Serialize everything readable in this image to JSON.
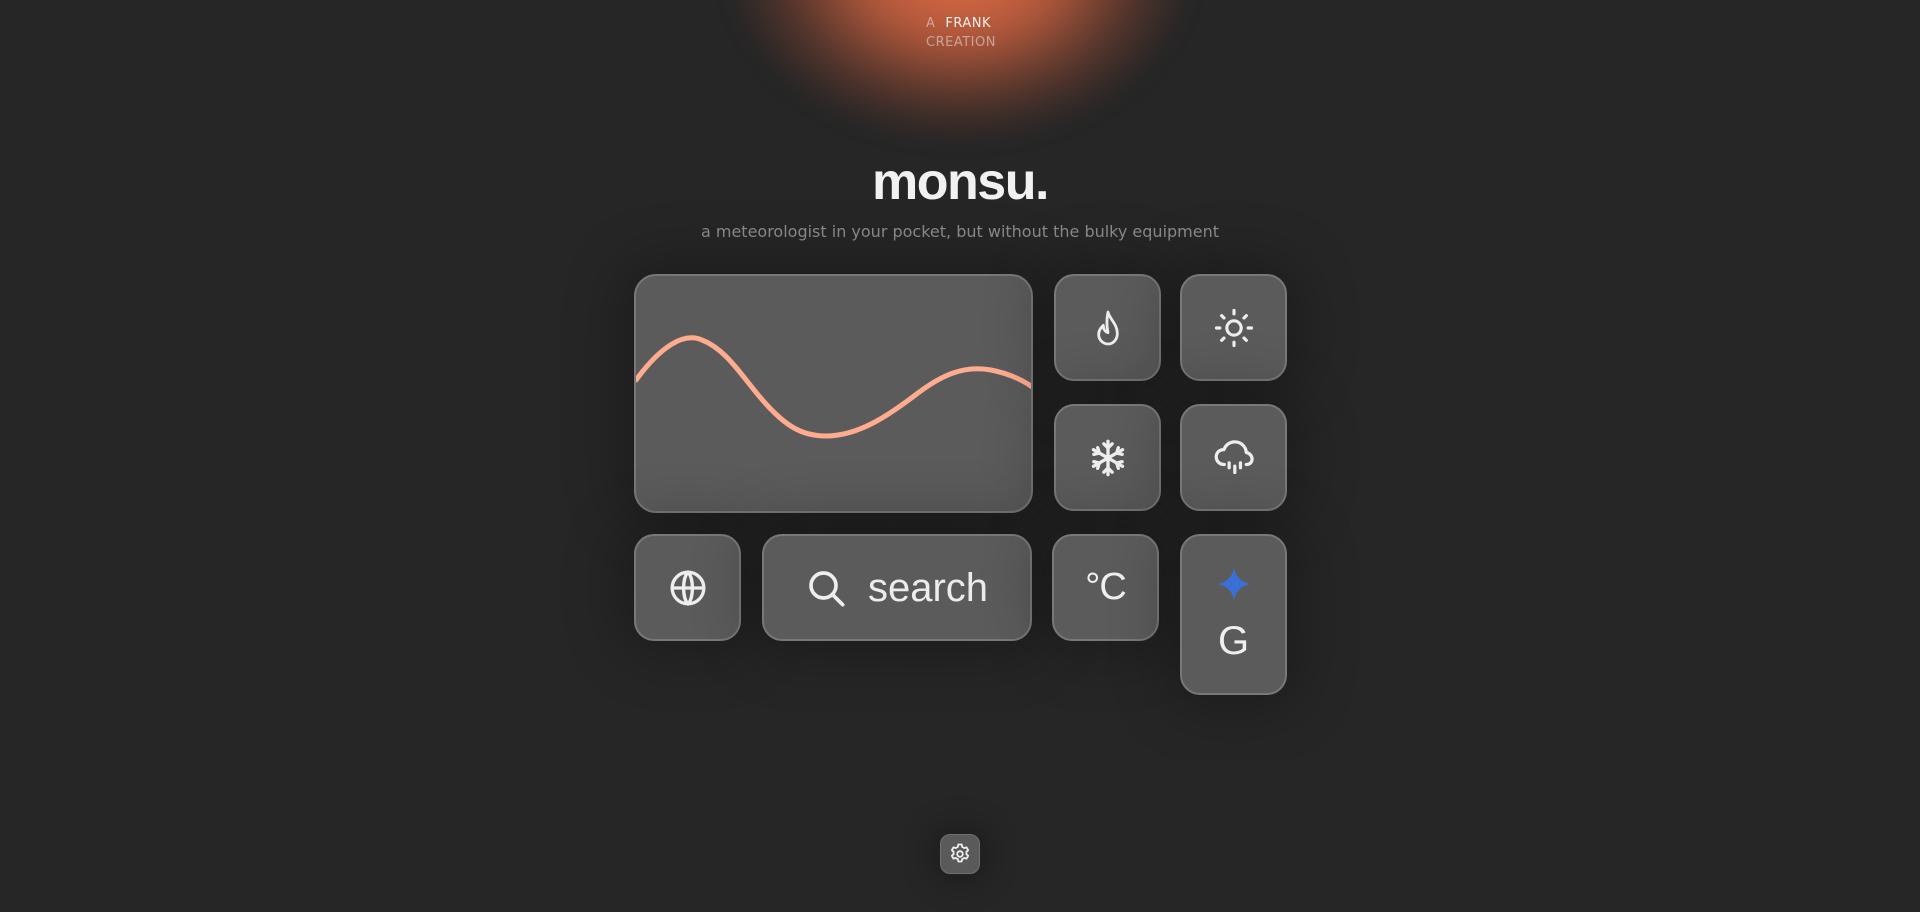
{
  "credit": {
    "prefix": "A",
    "name": "FRANK",
    "suffix": "CREATION"
  },
  "title": "monsu.",
  "subtitle": "a meteorologist in your pocket, but without the bulky equipment",
  "colors": {
    "background": "#262626",
    "tile": "#5b5b5b",
    "tile_border": "#787878",
    "wave": "#ffab8f",
    "glow": "#e46e46",
    "gemini_star": "#3a6fd8"
  },
  "tiles": {
    "wave_graph": {
      "icon": "temperature-wave"
    },
    "flame": {
      "icon": "flame-icon"
    },
    "sun": {
      "icon": "sun-icon"
    },
    "snow": {
      "icon": "snowflake-icon"
    },
    "rain": {
      "icon": "cloud-rain-icon"
    },
    "globe": {
      "icon": "globe-icon"
    },
    "search": {
      "icon": "search-icon",
      "label": "search"
    },
    "unit": {
      "label": "°C"
    },
    "gemini": {
      "icon": "sparkle-icon",
      "label": "G"
    }
  },
  "settings": {
    "icon": "gear-icon"
  }
}
